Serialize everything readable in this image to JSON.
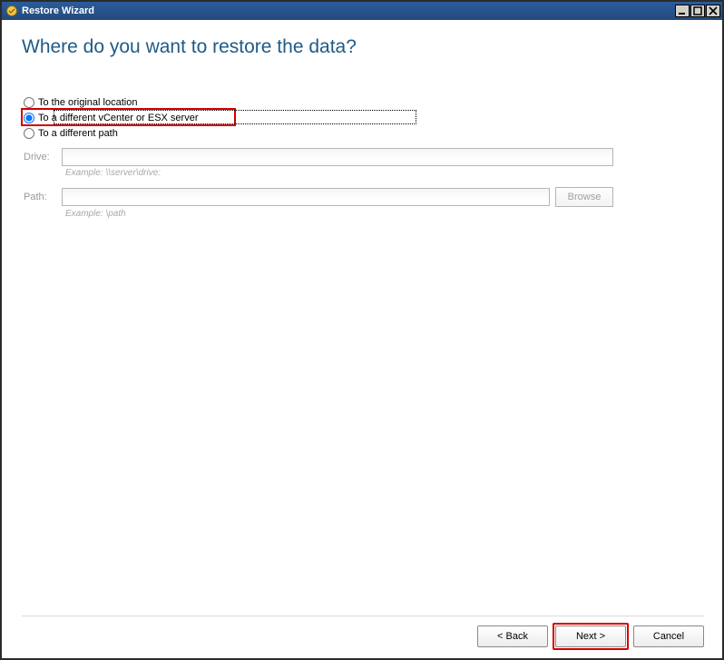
{
  "window": {
    "title": "Restore Wizard"
  },
  "page": {
    "heading": "Where do you want to restore the data?"
  },
  "options": {
    "original": "To the original location",
    "different_server": "To a different vCenter or ESX server",
    "different_path": "To a different path"
  },
  "fields": {
    "drive_label": "Drive:",
    "drive_value": "",
    "drive_example": "Example: \\\\server\\drive:",
    "path_label": "Path:",
    "path_value": "",
    "path_example": "Example: \\path",
    "browse_label": "Browse"
  },
  "buttons": {
    "back": "< Back",
    "next": "Next >",
    "cancel": "Cancel"
  }
}
